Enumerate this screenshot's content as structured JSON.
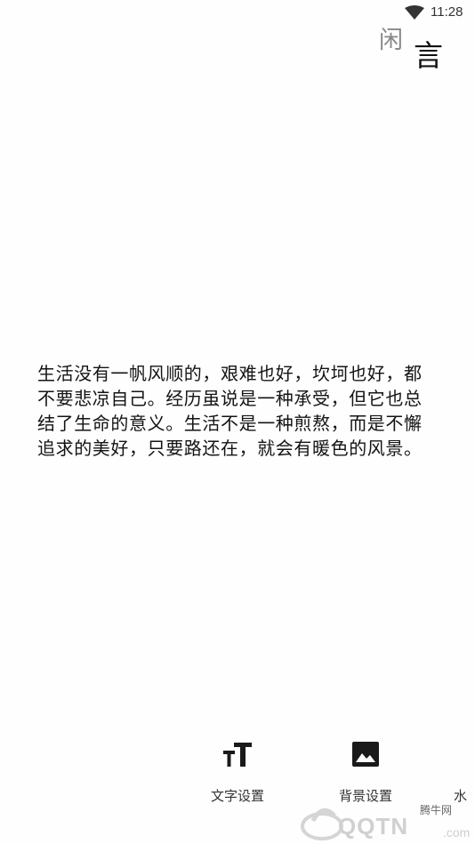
{
  "status_bar": {
    "time": "11:28"
  },
  "header": {
    "title_first": "闲",
    "title_second": "言"
  },
  "quote": {
    "text": " 生活没有一帆风顺的，艰难也好，坎坷也好，都不要悲凉自己。经历虽说是一种承受，但它也总结了生命的意义。生活不是一种煎熬，而是不懈追求的美好，只要路还在，就会有暖色的风景。"
  },
  "toolbar": {
    "text_settings_label": "文字设置",
    "background_settings_label": "背景设置",
    "watermark_label": "水"
  },
  "watermark": {
    "site_name": "腾牛网",
    "brand": "QQTN",
    "suffix": ".com"
  },
  "colors": {
    "background": "#fefefe",
    "text": "#141414",
    "title_muted": "#888888",
    "icon": "#1a1a1a"
  }
}
